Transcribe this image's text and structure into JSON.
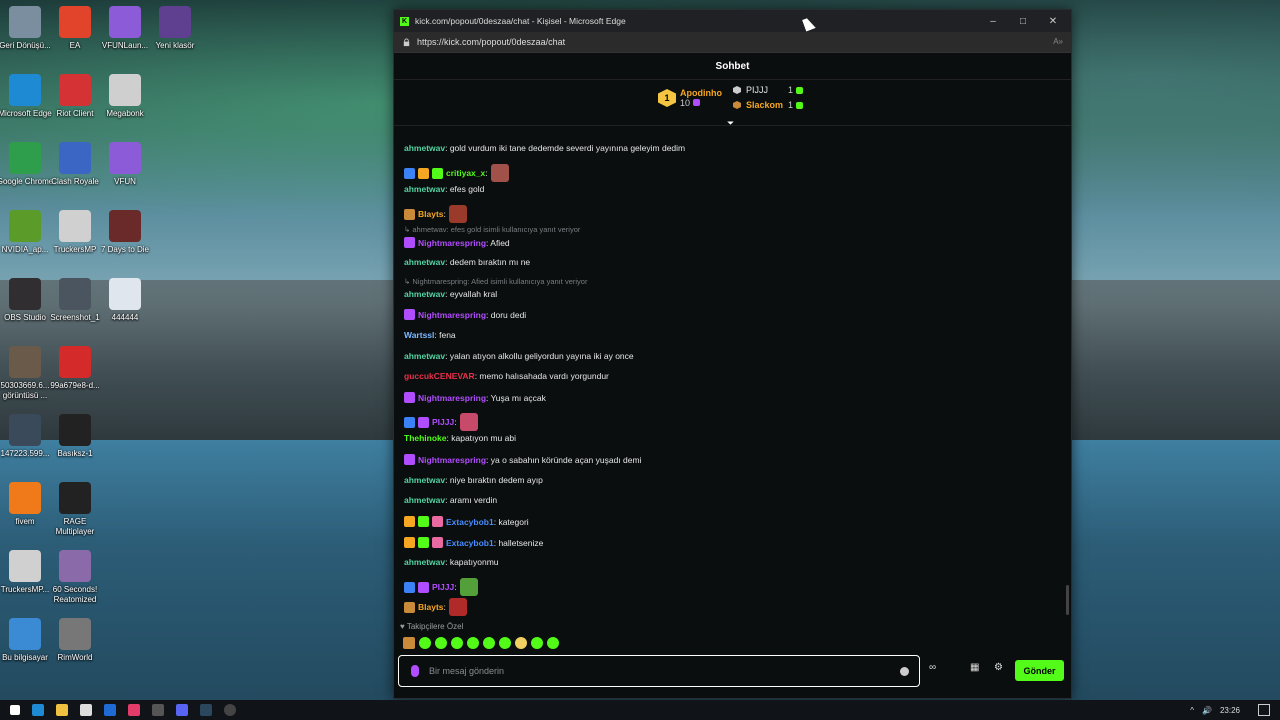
{
  "desktop": {
    "icons": [
      {
        "label": "Geri Dönüşü...",
        "icon": "recycle-bin-icon",
        "color": "#7a8ea0"
      },
      {
        "label": "EA",
        "icon": "ea-icon",
        "color": "#e2432b"
      },
      {
        "label": "VFUNLaun...",
        "icon": "vfun-launcher-icon",
        "color": "#8b5bd8"
      },
      {
        "label": "Yeni klasör",
        "icon": "archive-icon",
        "color": "#5f3f8f"
      },
      {
        "label": "Microsoft Edge",
        "icon": "edge-icon",
        "color": "#1f8ad4"
      },
      {
        "label": "Riot Client",
        "icon": "riot-icon",
        "color": "#d53235"
      },
      {
        "label": "Megabonk",
        "icon": "megabonk-icon",
        "color": "#cfcfcf"
      },
      {
        "label": "Google Chrome",
        "icon": "chrome-icon",
        "color": "#2e9d4c"
      },
      {
        "label": "Clash Royale",
        "icon": "clash-royale-icon",
        "color": "#3c66c4"
      },
      {
        "label": "VFUN",
        "icon": "vfun-icon",
        "color": "#8b5bd8"
      },
      {
        "label": "NVIDIA_ap...",
        "icon": "nvidia-icon",
        "color": "#5b9b2a"
      },
      {
        "label": "TruckersMP",
        "icon": "truckersmp-icon",
        "color": "#d0d0d0"
      },
      {
        "label": "7 Days to Die",
        "icon": "7days-icon",
        "color": "#6a2a2a"
      },
      {
        "label": "OBS Studio",
        "icon": "obs-icon",
        "color": "#302e31"
      },
      {
        "label": "Screenshot_1",
        "icon": "screenshot-icon",
        "color": "#4a5560"
      },
      {
        "label": "444444",
        "icon": "document-icon",
        "color": "#dfe6ee"
      },
      {
        "label": "50303669.6... görüntüsü ...",
        "icon": "image-file-icon",
        "color": "#6a5a4a"
      },
      {
        "label": "99a679e8-d...",
        "icon": "pdf-icon",
        "color": "#d52a2a"
      },
      {
        "label": "147223.599...",
        "icon": "image-file-icon",
        "color": "#3a4a5a"
      },
      {
        "label": "Basıksz-1",
        "icon": "app-icon",
        "color": "#222"
      },
      {
        "label": "fivem",
        "icon": "fivem-icon",
        "color": "#f07a1a"
      },
      {
        "label": "RAGE Multiplayer",
        "icon": "rage-icon",
        "color": "#222"
      },
      {
        "label": "TruckersMP...",
        "icon": "truckersmp-icon",
        "color": "#d0d0d0"
      },
      {
        "label": "60 Seconds! Reatomized",
        "icon": "60-seconds-icon",
        "color": "#8a6aa8"
      },
      {
        "label": "Bu bilgisayar",
        "icon": "computer-icon",
        "color": "#3a8ad4"
      },
      {
        "label": "RimWorld",
        "icon": "rimworld-icon",
        "color": "#777"
      }
    ]
  },
  "window": {
    "title": "kick.com/popout/0deszaa/chat - Kişisel - Microsoft Edge",
    "url": "https://kick.com/popout/0deszaa/chat",
    "minimize": "–",
    "maximize": "□",
    "close": "✕"
  },
  "chat": {
    "header": "Sohbet",
    "top_gifters": [
      {
        "rank": "1",
        "name": "Apodinho",
        "count": "10",
        "color": "#f5a623"
      },
      {
        "rank": "",
        "name": "PIJJJ",
        "count": "1",
        "color": "#e6e6e6"
      },
      {
        "rank": "",
        "name": "Slackom",
        "count": "1",
        "color": "#f5a623"
      }
    ],
    "messages": [
      {
        "user": "ahmetwav",
        "color": "#52d4a3",
        "text": ": gold vurdum iki tane dedemde severdi yayınına geleyim dedim"
      },
      {
        "user": "critiyax_x",
        "color": "#53fc18",
        "text": ":"
      },
      {
        "user": "ahmetwav",
        "color": "#52d4a3",
        "text": ": efes gold"
      },
      {
        "user": "Blayts",
        "color": "#f5a623",
        "text": ":"
      },
      {
        "reply": "ahmetwav: efes gold isimli kullanıcıya yanıt veriyor"
      },
      {
        "user": "Nightmarespring",
        "color": "#b04dff",
        "text": ": Afied"
      },
      {
        "user": "ahmetwav",
        "color": "#52d4a3",
        "text": ": dedem bıraktın mı ne"
      },
      {
        "reply": "Nightmarespring: Afied isimli kullanıcıya yanıt veriyor"
      },
      {
        "user": "ahmetwav",
        "color": "#52d4a3",
        "text": ": eyvallah kral"
      },
      {
        "user": "Nightmarespring",
        "color": "#b04dff",
        "text": ": doru dedi"
      },
      {
        "user": "Wartssl",
        "color": "#7db9ff",
        "text": ": fena"
      },
      {
        "user": "ahmetwav",
        "color": "#52d4a3",
        "text": ": yalan atıyon alkollu geliyordun yayına iki ay once"
      },
      {
        "user": "guccukCENEVAR",
        "color": "#e8304a",
        "text": ": memo halısahada vardı yorgundur"
      },
      {
        "user": "Nightmarespring",
        "color": "#b04dff",
        "text": ": Yuşa mı açcak"
      },
      {
        "user": "PIJJJ",
        "color": "#b04dff",
        "text": ":"
      },
      {
        "user": "Thehinoke",
        "color": "#53fc18",
        "text": ": kapatıyon mu abi"
      },
      {
        "user": "Nightmarespring",
        "color": "#b04dff",
        "text": ": ya o sabahın köründe açan yuşadı demi"
      },
      {
        "user": "ahmetwav",
        "color": "#52d4a3",
        "text": ": niye bıraktın dedem ayıp"
      },
      {
        "user": "ahmetwav",
        "color": "#52d4a3",
        "text": ": aramı verdin"
      },
      {
        "user": "Extacybob1",
        "color": "#4a8cff",
        "text": ": kategori"
      },
      {
        "user": "Extacybob1",
        "color": "#4a8cff",
        "text": ": halletsenize"
      },
      {
        "user": "ahmetwav",
        "color": "#52d4a3",
        "text": ": kapatıyonmu"
      },
      {
        "user": "PIJJJ",
        "color": "#b04dff",
        "text": ":"
      },
      {
        "user": "Blayts",
        "color": "#f5a623",
        "text": ":"
      }
    ],
    "subscriber_label": "Takipçilere Özel",
    "input_placeholder": "Bir mesaj gönderin",
    "send_label": "Gönder"
  },
  "taskbar": {
    "time": "23:26"
  },
  "colors": {
    "kick_green": "#53fc18",
    "window_bg": "#0b0e0f"
  }
}
